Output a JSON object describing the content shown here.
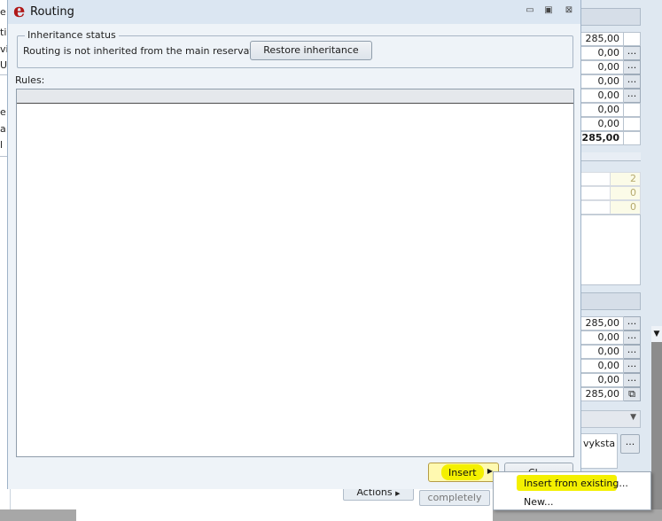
{
  "dialog": {
    "title": "Routing",
    "logo_letter": "e",
    "window_buttons": {
      "minimize": "▭",
      "maximize": "▣",
      "close": "⊠"
    },
    "inheritance": {
      "legend": "Inheritance status",
      "message": "Routing is not inherited from the main reservation.",
      "restore_button": "Restore inheritance"
    },
    "rules_label": "Rules:",
    "insert_button": "Insert",
    "close_button": "Cl..."
  },
  "context_menu": {
    "items": [
      {
        "label": "Insert from existing..."
      },
      {
        "label": "New..."
      }
    ]
  },
  "background": {
    "left_fragments": [
      "e:",
      "ti",
      "vi",
      "U",
      "e",
      "a",
      "l"
    ],
    "amounts_top": [
      "285,00",
      "0,00",
      "0,00",
      "0,00",
      "0,00",
      "0,00",
      "0,00",
      "285,00"
    ],
    "counts": [
      "2",
      "0",
      "0"
    ],
    "amounts_bottom": [
      "285,00",
      "0,00",
      "0,00",
      "0,00",
      "0,00",
      "285,00"
    ],
    "vyksta": "vyksta",
    "dots_label": "...",
    "actions_button": "Actions",
    "completely_button": "completely"
  },
  "colors": {
    "highlight": "#f4f000",
    "logo_red": "#b01818",
    "dialog_bg": "#dbe6f2"
  }
}
